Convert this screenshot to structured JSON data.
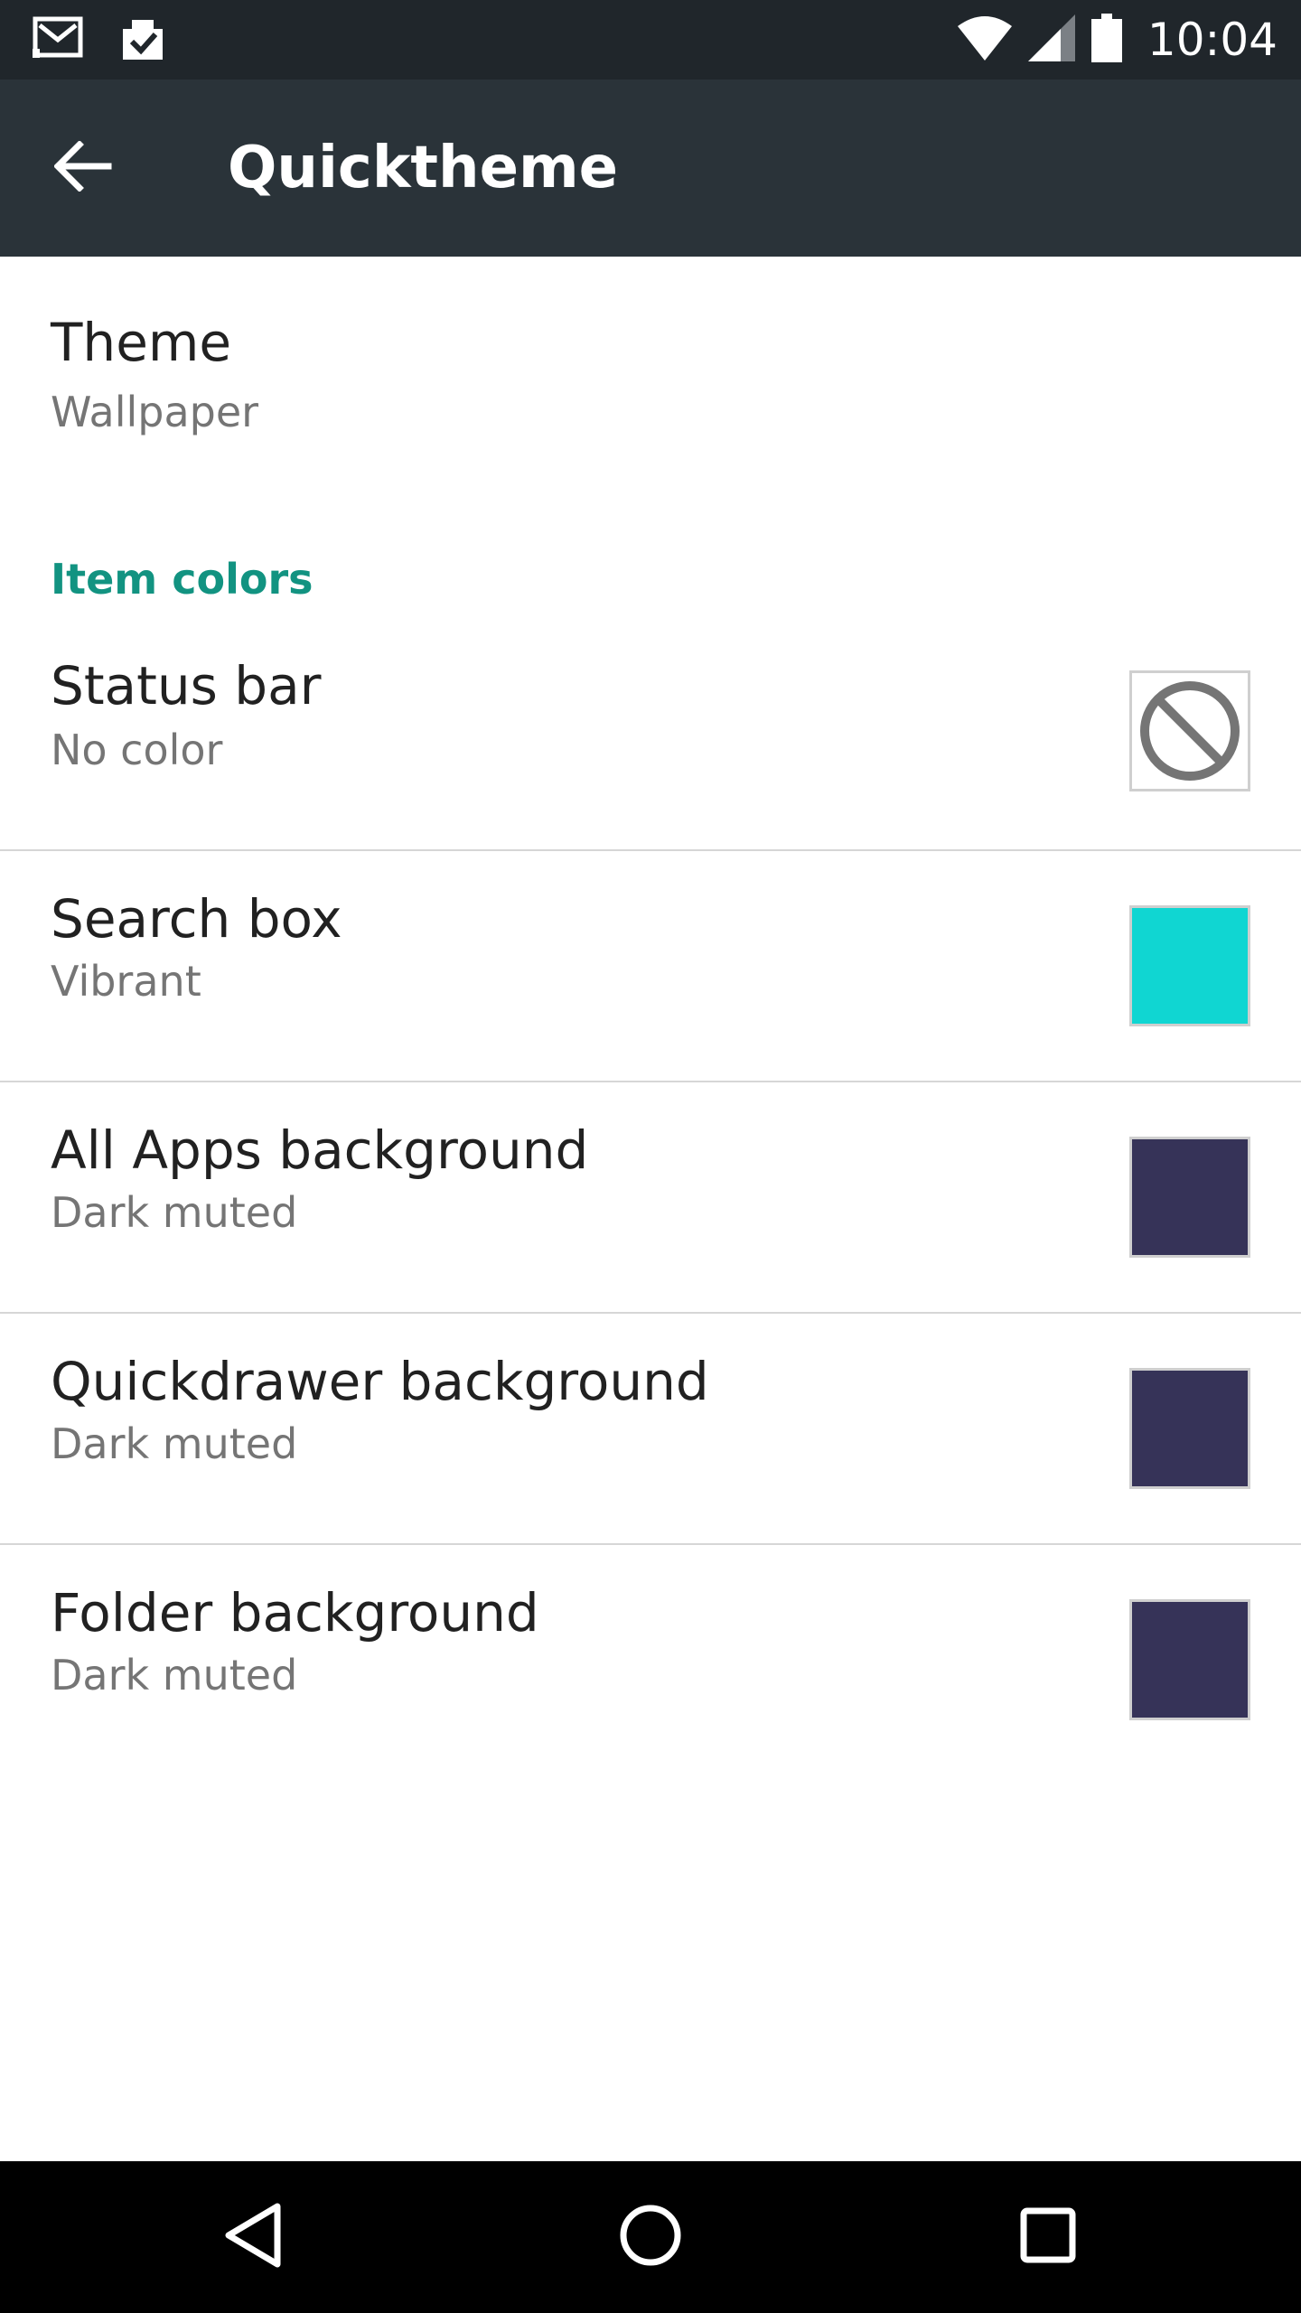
{
  "status_bar": {
    "time": "10:04",
    "icons": [
      "gmail-icon",
      "inbox-check-icon",
      "wifi-icon",
      "signal-icon",
      "battery-icon"
    ]
  },
  "app_bar": {
    "title": "Quicktheme",
    "back_icon": "arrow-back-icon"
  },
  "theme_pref": {
    "title": "Theme",
    "summary": "Wallpaper"
  },
  "category": {
    "label": "Item colors",
    "color": "#129381"
  },
  "item_colors": [
    {
      "title": "Status bar",
      "summary": "No color",
      "swatch": "none"
    },
    {
      "title": "Search box",
      "summary": "Vibrant",
      "swatch": "#10d6d2"
    },
    {
      "title": "All Apps background",
      "summary": "Dark muted",
      "swatch": "#363358"
    },
    {
      "title": "Quickdrawer background",
      "summary": "Dark muted",
      "swatch": "#363358"
    },
    {
      "title": "Folder background",
      "summary": "Dark muted",
      "swatch": "#363358"
    }
  ],
  "nav_bar": {
    "icons": [
      "back-triangle-icon",
      "home-circle-icon",
      "recents-square-icon"
    ]
  }
}
